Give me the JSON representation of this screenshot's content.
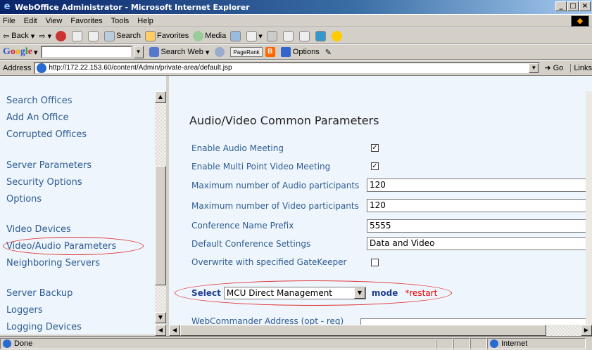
{
  "window": {
    "title": "WebOffice Administrator - Microsoft Internet Explorer"
  },
  "menu": [
    "File",
    "Edit",
    "View",
    "Favorites",
    "Tools",
    "Help"
  ],
  "toolbar": {
    "back": "Back",
    "search": "Search",
    "favorites": "Favorites",
    "media": "Media"
  },
  "google": {
    "logo": "Google",
    "search_web": "Search Web",
    "pagerank": "PageRank",
    "options": "Options"
  },
  "address": {
    "label": "Address",
    "url": "http://172.22.153.60/content/Admin/private-area/default.jsp",
    "go": "Go",
    "links": "Links"
  },
  "nav": {
    "items": [
      "Search Offices",
      "Add An Office",
      "Corrupted Offices",
      "Server Parameters",
      "Security Options",
      "Options",
      "Video Devices",
      "Video/Audio Parameters",
      "Neighboring Servers",
      "Server Backup",
      "Loggers",
      "Logging Devices"
    ]
  },
  "main": {
    "heading": "Audio/Video Common Parameters",
    "params": [
      {
        "label": "Enable Audio Meeting",
        "type": "checkbox",
        "checked": true
      },
      {
        "label": "Enable Multi Point Video Meeting",
        "type": "checkbox",
        "checked": true
      },
      {
        "label": "Maximum number of Audio participants",
        "type": "text",
        "value": "120"
      },
      {
        "label": "Maximum number of Video participants",
        "type": "text",
        "value": "120"
      },
      {
        "label": "Conference Name Prefix",
        "type": "text",
        "value": "5555"
      },
      {
        "label": "Default Conference Settings",
        "type": "text",
        "value": "Data and Video"
      },
      {
        "label": "Overwrite with specified GateKeeper",
        "type": "checkbox",
        "checked": false
      }
    ],
    "select_label": "Select",
    "select_value": "MCU Direct Management",
    "mode_label": "mode",
    "restart_label": "*restart",
    "cutoff_label": "WebCommander Address (opt - req)"
  },
  "status": {
    "text": "Done",
    "zone": "Internet"
  }
}
